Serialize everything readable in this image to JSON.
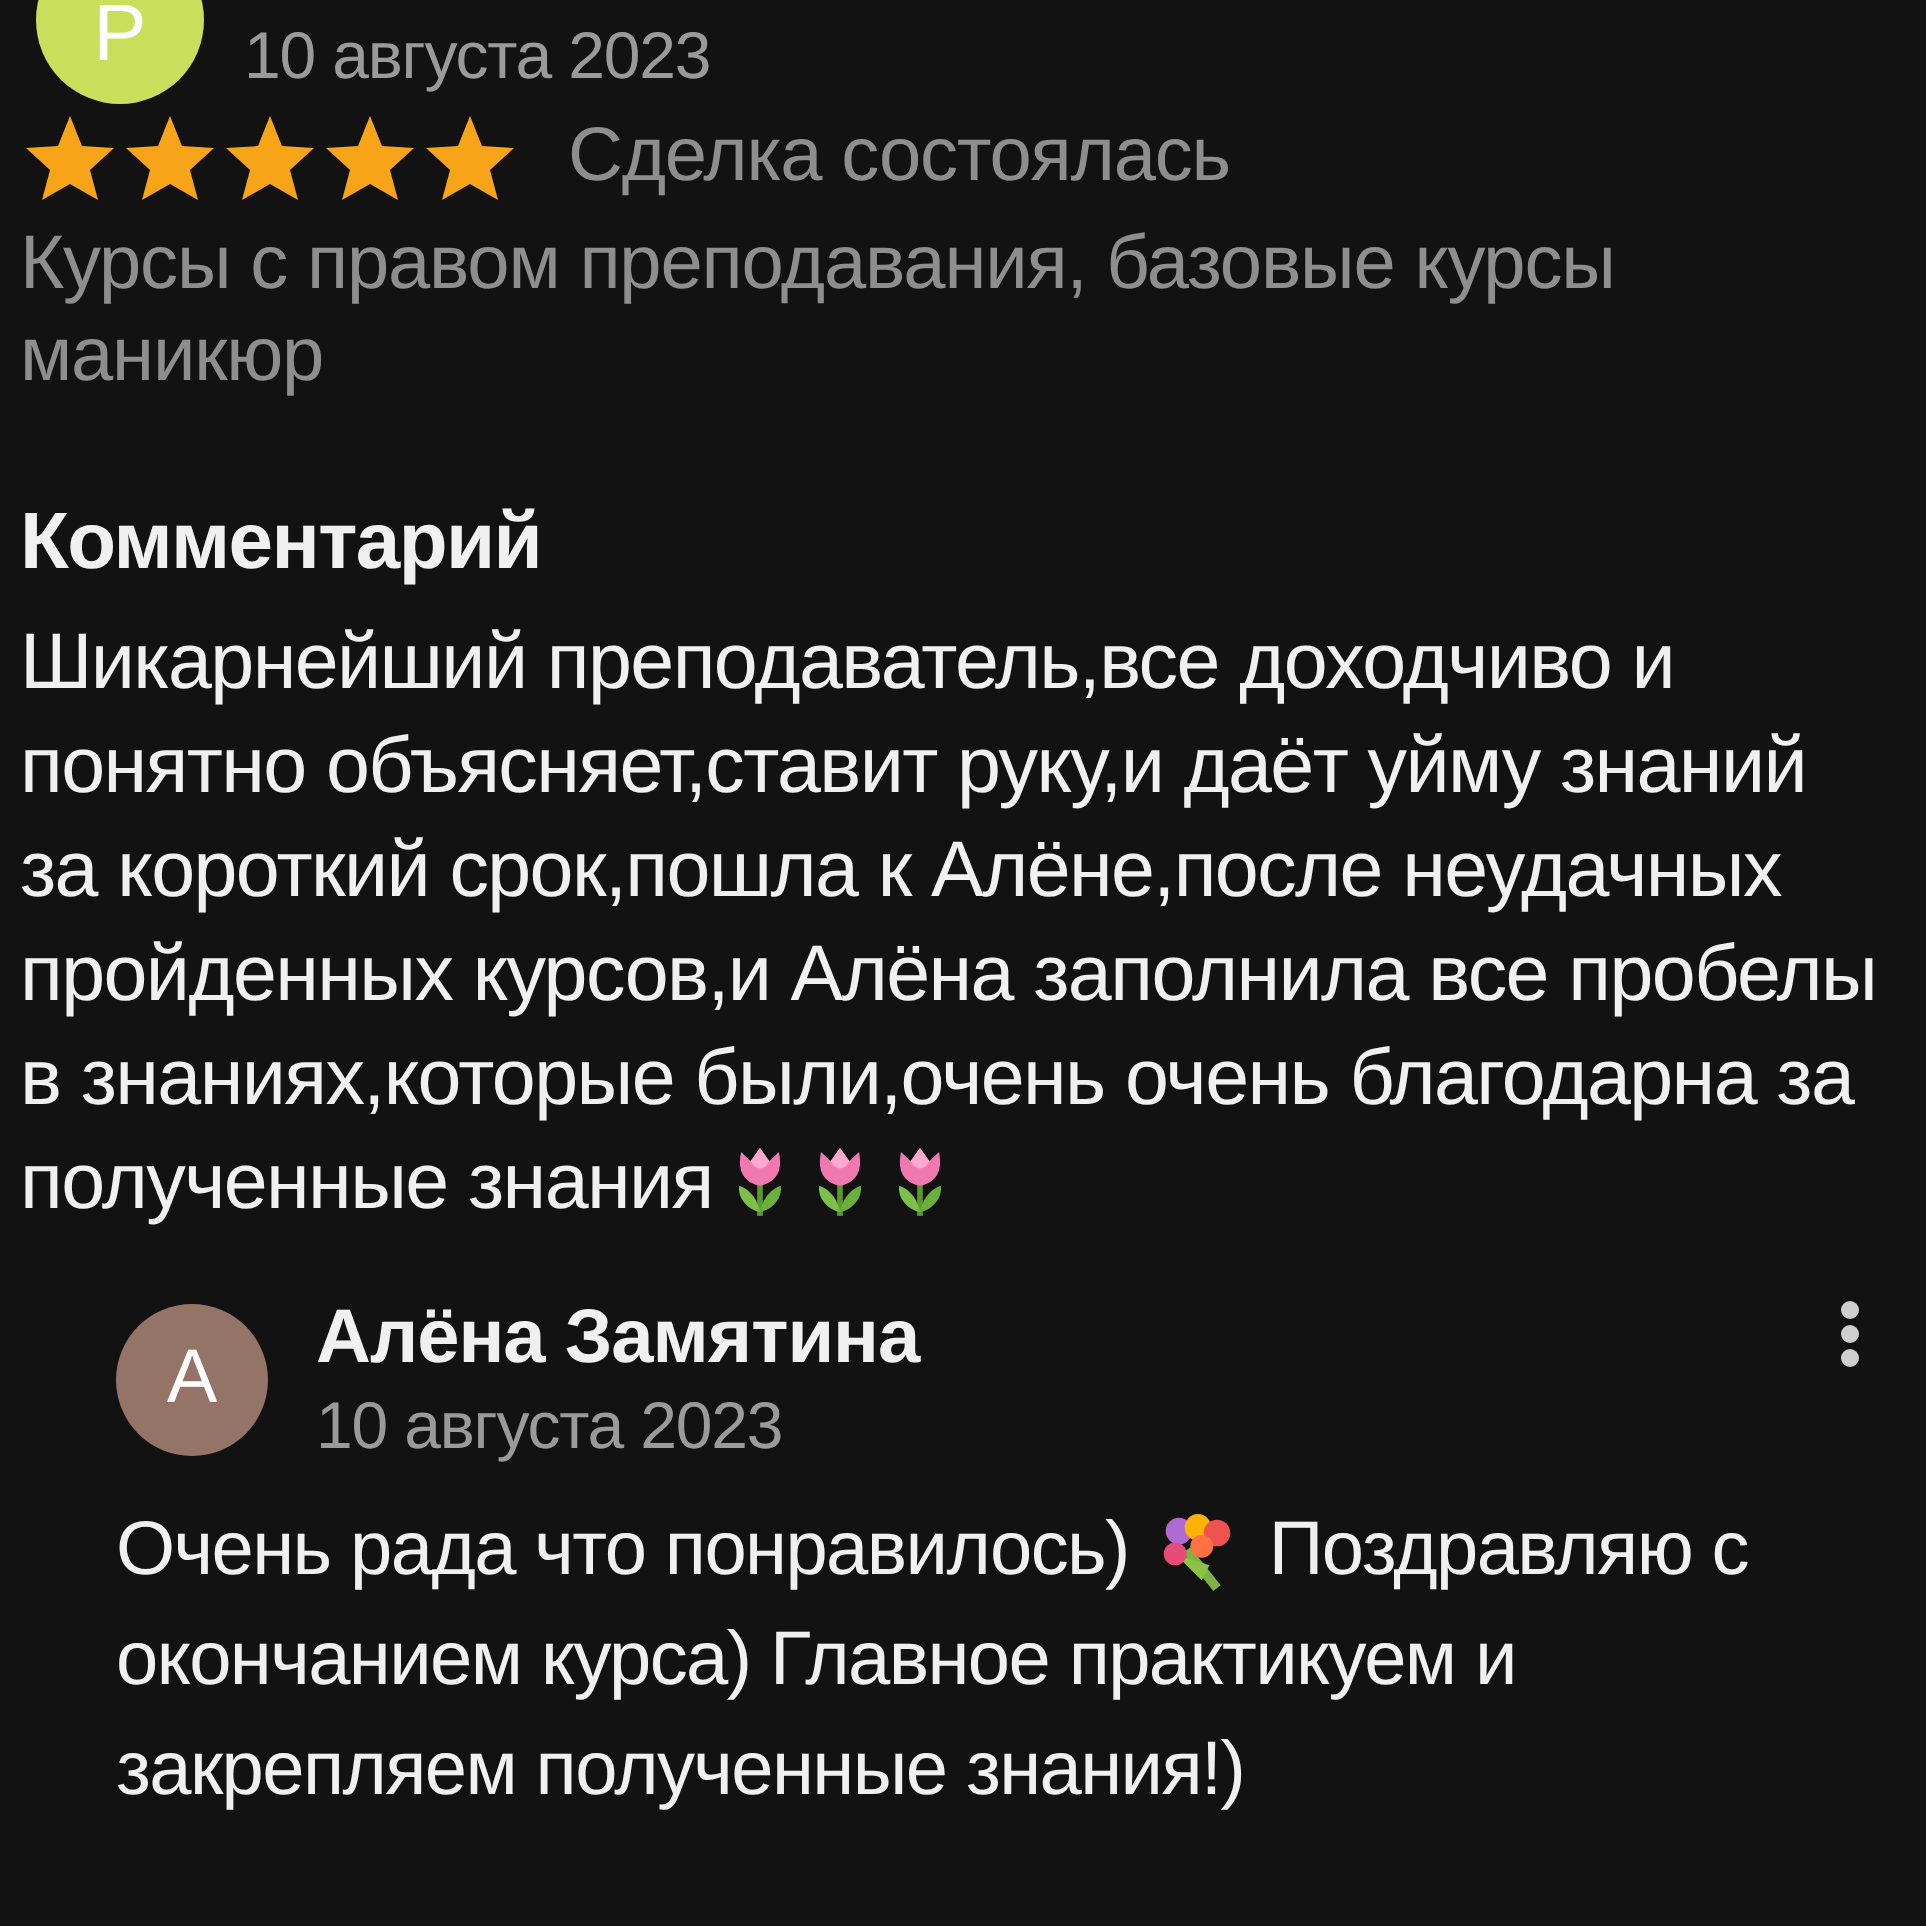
{
  "review": {
    "author_initial": "Р",
    "date": "10 августа 2023",
    "stars": 5,
    "deal_status": "Сделка состоялась",
    "service": "Курсы с правом преподавания, базовые курсы маникюр",
    "comment_heading": "Комментарий",
    "comment_lines": [
      {
        "parts": [
          {
            "text": "Шикарнейший преподаватель,все доходчиво и"
          }
        ]
      },
      {
        "parts": [
          {
            "text": "понятно объясняет,ставит руку,и даёт уйму знаний"
          }
        ]
      },
      {
        "parts": [
          {
            "text": "за короткий срок,пошла к Алёне,после неудачных"
          }
        ]
      },
      {
        "parts": [
          {
            "text": "пройденных курсов,и Алёна заполнила все пробелы"
          }
        ]
      },
      {
        "parts": [
          {
            "text": "в знаниях,которые были,очень очень благодарна за"
          }
        ]
      },
      {
        "parts": [
          {
            "text": "полученные знания"
          },
          {
            "kind": "tulip"
          },
          {
            "kind": "tulip"
          },
          {
            "kind": "tulip"
          }
        ]
      }
    ]
  },
  "reply": {
    "author_initial": "А",
    "author": "Алёна Замятина",
    "date": "10 августа 2023",
    "lines": [
      {
        "parts": [
          {
            "text": "Очень рада что понравилось)"
          },
          {
            "kind": "bouquet"
          },
          {
            "text": "Поздравляю с"
          }
        ]
      },
      {
        "parts": [
          {
            "text": "окончанием курса) Главное практикуем и"
          }
        ]
      },
      {
        "parts": [
          {
            "text": "закрепляем полученные знания!)"
          }
        ]
      }
    ]
  }
}
